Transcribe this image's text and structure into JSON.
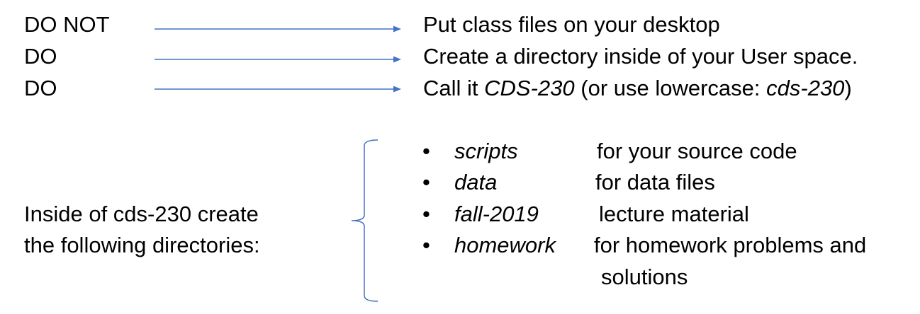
{
  "rules": [
    {
      "label": "DO NOT",
      "parts": [
        {
          "text": "Put class files on your desktop",
          "italic": false
        }
      ]
    },
    {
      "label": "DO",
      "parts": [
        {
          "text": "Create a directory inside of your User space.",
          "italic": false
        }
      ]
    },
    {
      "label": "DO",
      "parts": [
        {
          "text": "Call it ",
          "italic": false
        },
        {
          "text": "CDS-230",
          "italic": true
        },
        {
          "text": " (or use lowercase: ",
          "italic": false
        },
        {
          "text": "cds-230",
          "italic": true
        },
        {
          "text": ")",
          "italic": false
        }
      ]
    }
  ],
  "instruction": {
    "line1": "Inside of cds-230 create",
    "line2": "the following directories:"
  },
  "directories": [
    {
      "name": "scripts",
      "description": "for your source code"
    },
    {
      "name": "data",
      "description": "for data files"
    },
    {
      "name": "fall-2019",
      "description": "lecture material"
    },
    {
      "name": "homework",
      "description": "for homework problems and",
      "continuation": "solutions"
    }
  ],
  "bullet_char": "•",
  "colors": {
    "text": "#000000",
    "arrow": "#4472c4",
    "brace": "#4472c4"
  }
}
